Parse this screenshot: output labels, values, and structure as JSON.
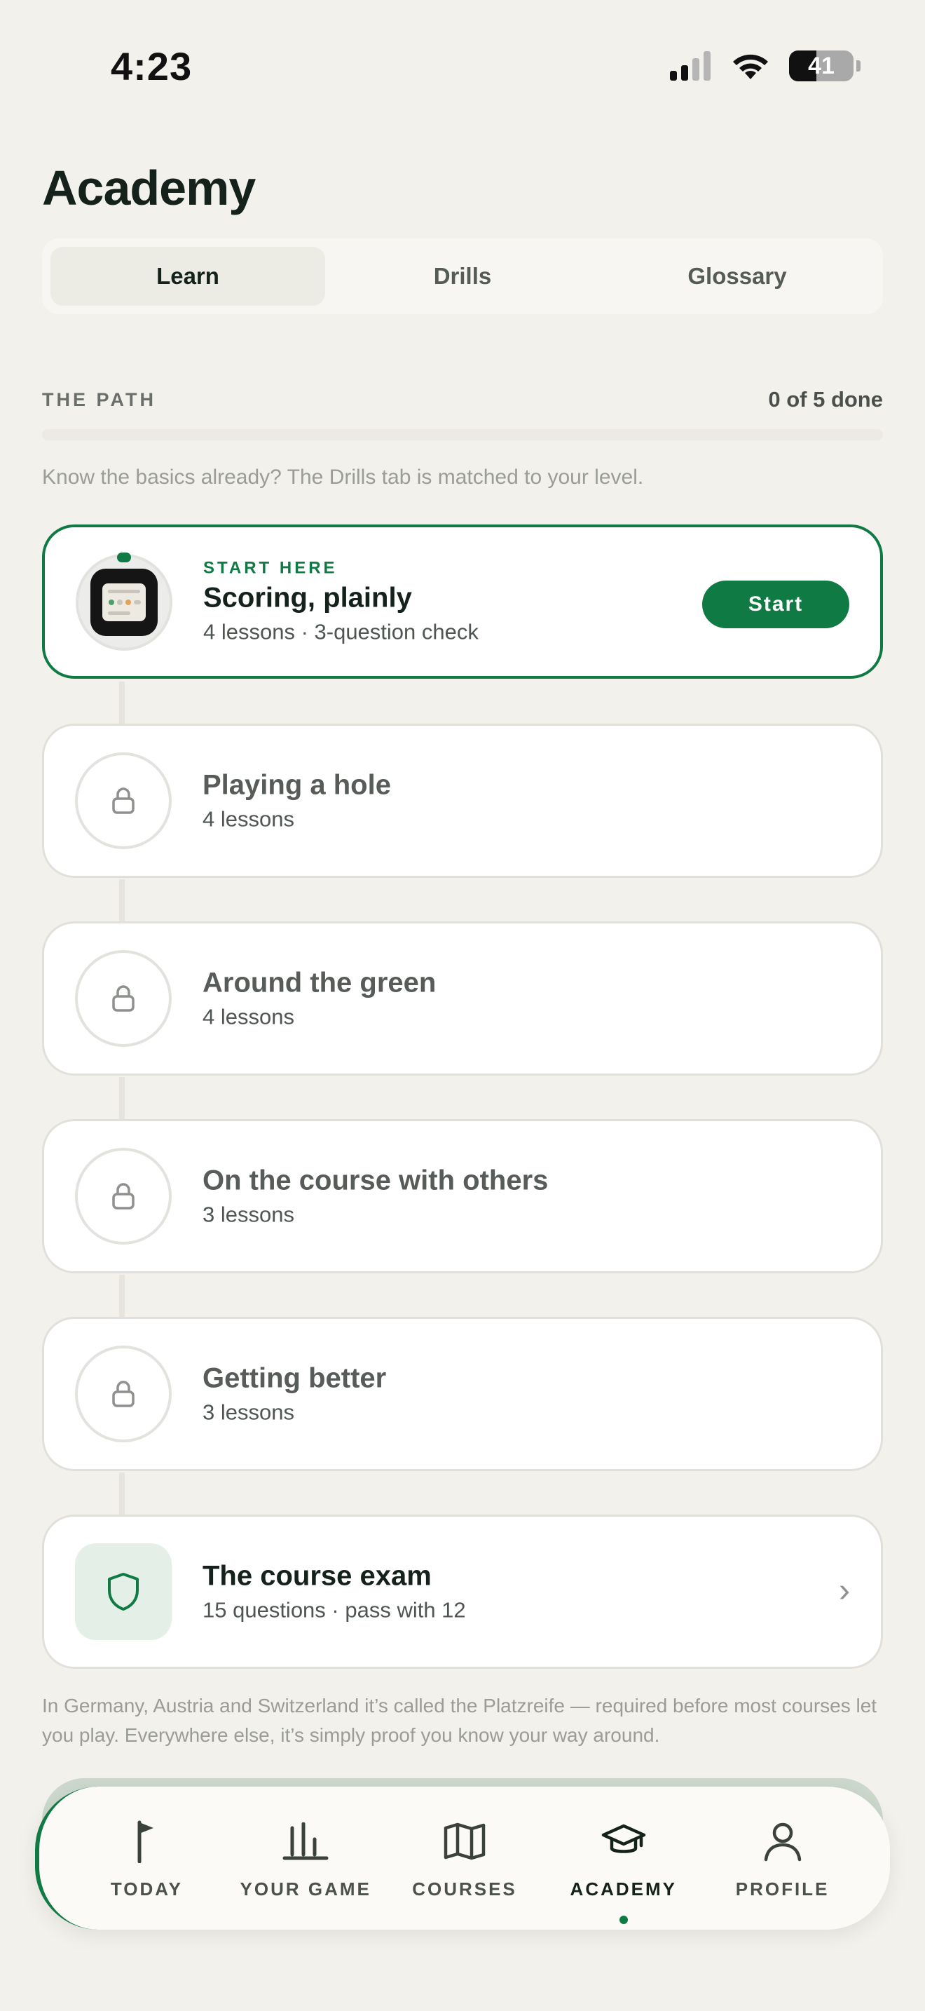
{
  "status": {
    "time": "4:23",
    "battery": "41"
  },
  "header": {
    "title": "Academy"
  },
  "segments": [
    {
      "label": "Learn",
      "active": true
    },
    {
      "label": "Drills",
      "active": false
    },
    {
      "label": "Glossary",
      "active": false
    }
  ],
  "path": {
    "label": "THE PATH",
    "count": "0 of 5 done",
    "progress": 0,
    "hint": "Know the basics already? The Drills tab is matched to your level."
  },
  "modules": [
    {
      "eyebrow": "START HERE",
      "title": "Scoring, plainly",
      "subtitle": "4 lessons · 3-question check",
      "action": "Start",
      "locked": false
    },
    {
      "title": "Playing a hole",
      "subtitle": "4 lessons",
      "locked": true
    },
    {
      "title": "Around the green",
      "subtitle": "4 lessons",
      "locked": true
    },
    {
      "title": "On the course with others",
      "subtitle": "3 lessons",
      "locked": true
    },
    {
      "title": "Getting better",
      "subtitle": "3 lessons",
      "locked": true
    }
  ],
  "exam": {
    "title": "The course exam",
    "subtitle": "15 questions · pass with 12"
  },
  "footnote": "In Germany, Austria and Switzerland it’s called the Platzreife — required before most courses let you play. Everywhere else, it’s simply proof you know your way around.",
  "tabs": [
    {
      "label": "TODAY",
      "icon": "flag-icon"
    },
    {
      "label": "YOUR GAME",
      "icon": "bar-chart-icon"
    },
    {
      "label": "COURSES",
      "icon": "map-icon"
    },
    {
      "label": "ACADEMY",
      "icon": "graduation-cap-icon",
      "active": true
    },
    {
      "label": "PROFILE",
      "icon": "person-icon"
    }
  ],
  "colors": {
    "accent": "#107A44",
    "background": "#F3F1EC"
  }
}
